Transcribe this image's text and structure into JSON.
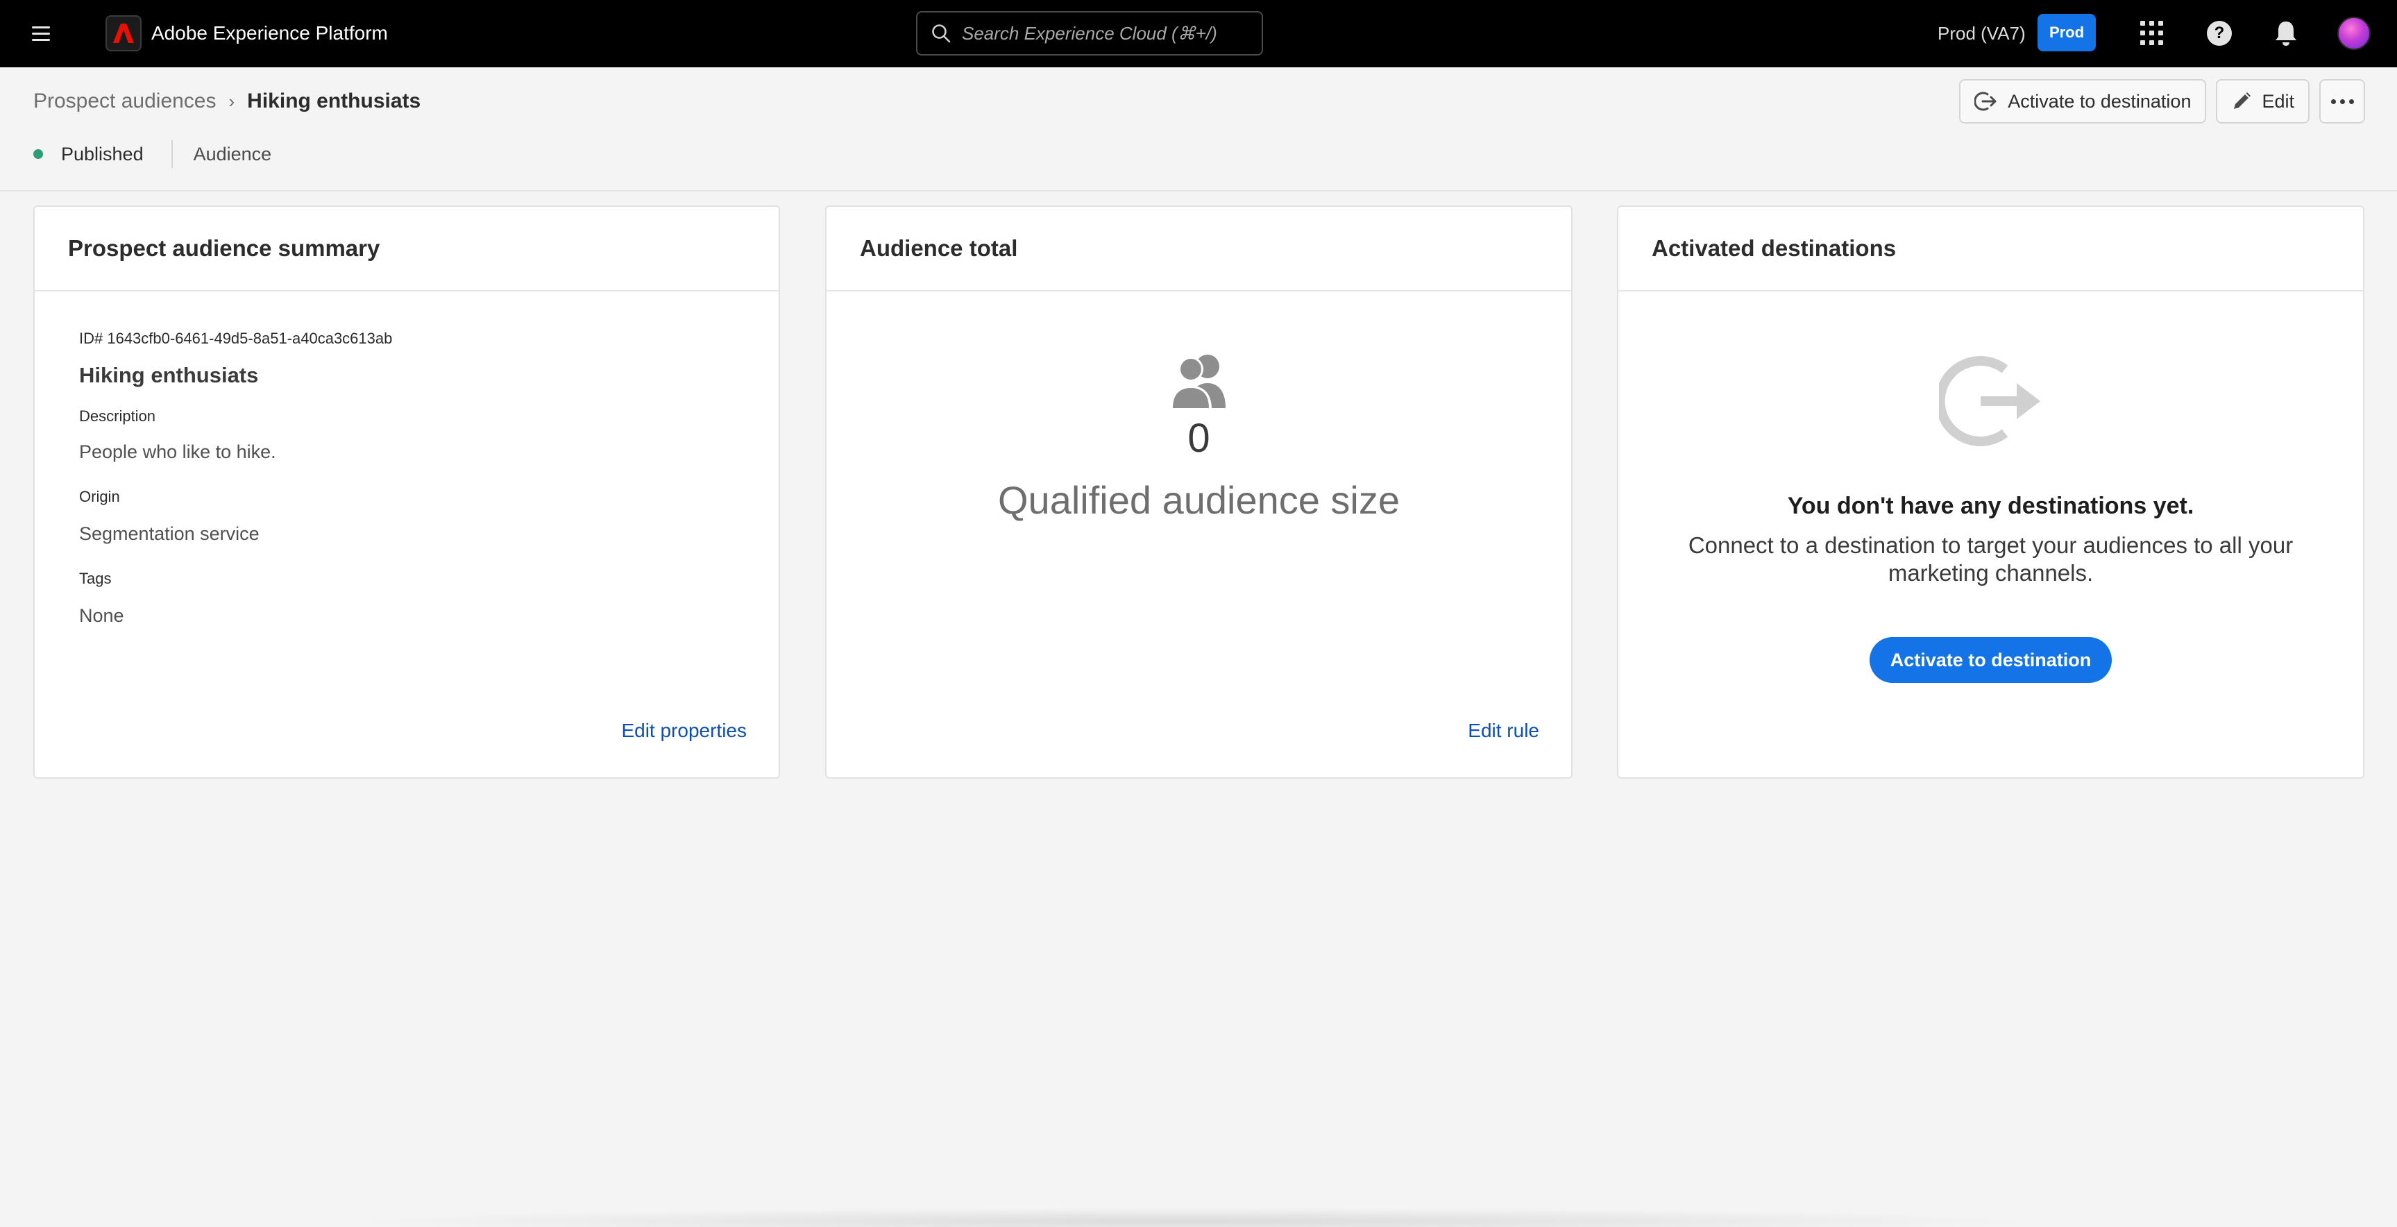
{
  "topbar": {
    "app_title": "Adobe Experience Platform",
    "search_placeholder": "Search Experience Cloud (⌘+/)",
    "org_label": "Prod (VA7)",
    "env_badge": "Prod",
    "icons": [
      "menu-icon",
      "adobe-logo-icon",
      "search-icon",
      "apps-grid-icon",
      "help-icon",
      "bell-icon",
      "user-avatar"
    ],
    "brand_color": "#eb1000",
    "accent_color": "#1473e6"
  },
  "header": {
    "breadcrumb": {
      "parent": "Prospect audiences",
      "separator": "›",
      "current": "Hiking enthusiats"
    },
    "status": "Published",
    "status_color": "#2d9d78",
    "type": "Audience",
    "actions": {
      "activate_label": "Activate to destination",
      "edit_label": "Edit",
      "more_icon": "more-icon"
    }
  },
  "cards": {
    "summary": {
      "title": "Prospect audience summary",
      "id_text": "ID# 1643cfb0-6461-49d5-8a51-a40ca3c613ab",
      "name": "Hiking enthusiats",
      "description_label": "Description",
      "description_value": "People who like to hike.",
      "origin_label": "Origin",
      "origin_value": "Segmentation service",
      "tags_label": "Tags",
      "tags_value": "None",
      "edit_link": "Edit properties"
    },
    "total": {
      "title": "Audience total",
      "count": "0",
      "label": "Qualified audience size",
      "edit_link": "Edit rule"
    },
    "destinations": {
      "title": "Activated destinations",
      "empty_title": "You don't have any destinations yet.",
      "empty_description": "Connect to a destination to target your audiences to all your marketing channels.",
      "button_label": "Activate to destination"
    }
  }
}
